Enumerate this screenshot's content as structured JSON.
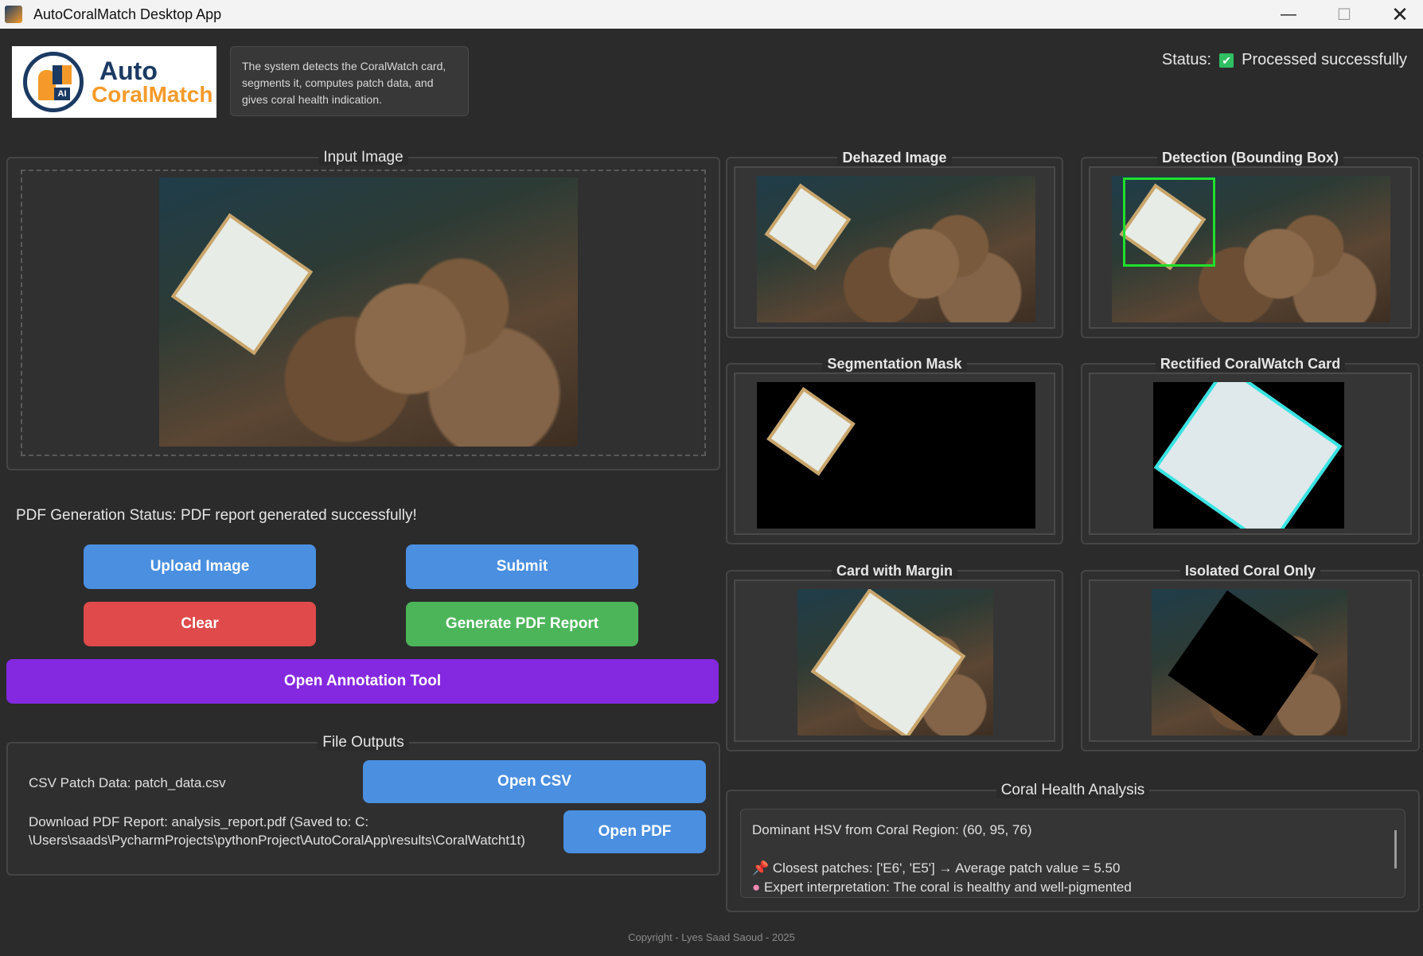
{
  "window": {
    "title": "AutoCoralMatch Desktop App",
    "minimize": "—",
    "maximize": "☐",
    "close": "✕"
  },
  "logo": {
    "word1": "Auto",
    "word2": "CoralMatch",
    "chip": "AI"
  },
  "info": {
    "text": "The system detects the CoralWatch card, segments it, computes patch data, and gives coral health indication."
  },
  "status": {
    "label": "Status:",
    "check": "✔",
    "value": "Processed successfully"
  },
  "panels": {
    "input": "Input Image",
    "dehazed": "Dehazed Image",
    "detection": "Detection (Bounding Box)",
    "segmentation": "Segmentation Mask",
    "rectified": "Rectified CoralWatch Card",
    "margin": "Card with Margin",
    "isolated": "Isolated Coral Only"
  },
  "pdf_status": "PDF Generation Status: PDF report generated successfully!",
  "buttons": {
    "upload": "Upload Image",
    "submit": "Submit",
    "clear": "Clear",
    "generate_pdf": "Generate PDF Report",
    "annotation": "Open Annotation Tool",
    "open_csv": "Open CSV",
    "open_pdf": "Open PDF"
  },
  "file_outputs": {
    "title": "File Outputs",
    "csv": "CSV Patch Data: patch_data.csv",
    "pdf_line1": "Download PDF Report: analysis_report.pdf (Saved to: C:",
    "pdf_line2": "\\Users\\saads\\PycharmProjects\\pythonProject\\AutoCoralApp\\results\\CoralWatcht1t)"
  },
  "health": {
    "title": "Coral Health Analysis",
    "hsv": "Dominant HSV from Coral Region: (60, 95, 76)",
    "pin_icon": "📌",
    "closest": "Closest patches: ['E6', 'E5'] → Average patch value = 5.50",
    "brain_icon": "●",
    "expert": "Expert interpretation: The coral is healthy and well-pigmented"
  },
  "copyright": "Copyright - Lyes Saad Saoud - 2025"
}
